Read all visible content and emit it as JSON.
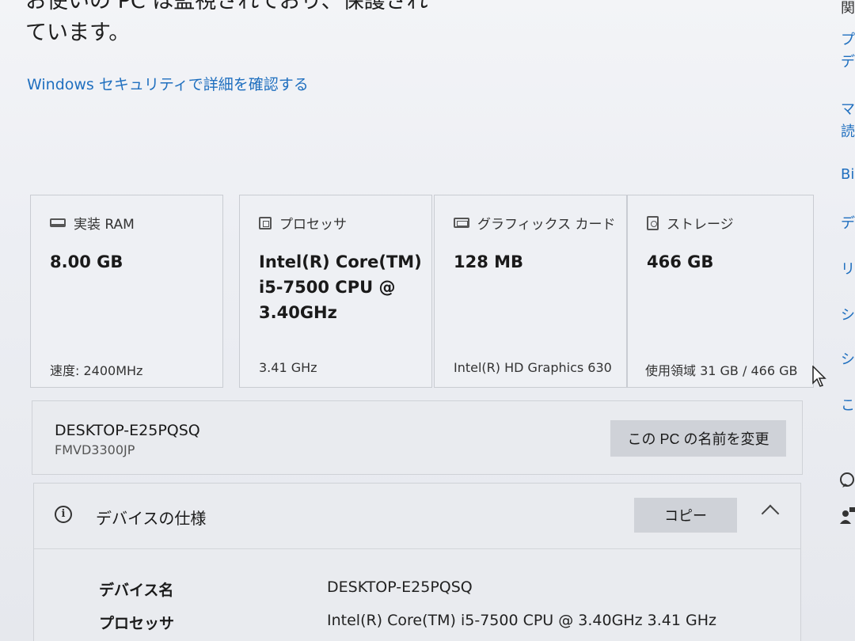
{
  "intro": {
    "line1": "お使いの PC は監視されており、保護され",
    "line2": "ています。"
  },
  "learn_link": "Windows セキュリティで詳細を確認する",
  "cards": {
    "ram": {
      "title": "実装 RAM",
      "value": "8.00 GB",
      "footer": "速度: 2400MHz"
    },
    "processor": {
      "title": "プロセッサ",
      "value": "Intel(R) Core(TM) i5-7500 CPU @ 3.40GHz",
      "footer": "3.41 GHz"
    },
    "graphics": {
      "title": "グラフィックス カード",
      "value": "128 MB",
      "footer": "Intel(R) HD Graphics 630"
    },
    "storage": {
      "title": "ストレージ",
      "value": "466 GB",
      "footer": "使用領域 31 GB / 466 GB"
    }
  },
  "pc": {
    "name": "DESKTOP-E25PQSQ",
    "model": "FMVD3300JP",
    "rename_label": "この PC の名前を変更"
  },
  "specs": {
    "title": "デバイスの仕様",
    "copy_label": "コピー",
    "rows": [
      {
        "key": "デバイス名",
        "value": "DESKTOP-E25PQSQ"
      },
      {
        "key": "プロセッサ",
        "value": "Intel(R) Core(TM) i5-7500 CPU @ 3.40GHz   3.41 GHz"
      }
    ]
  },
  "sidebar": {
    "items": [
      "関",
      "プ",
      "デ",
      "マ",
      "読",
      "Bi",
      "デ",
      "リモ",
      "シス",
      "シス",
      "この"
    ]
  },
  "icons": {
    "ram": "memory-icon",
    "processor": "processor-icon",
    "graphics": "display-adapter-icon",
    "storage": "storage-icon",
    "info": "info-icon",
    "collapse": "chevron-up-icon",
    "help": "help-icon",
    "feedback": "feedback-icon"
  },
  "colors": {
    "link": "#1f6fbf",
    "button": "#cfd2d8",
    "background": "#eceef2"
  }
}
